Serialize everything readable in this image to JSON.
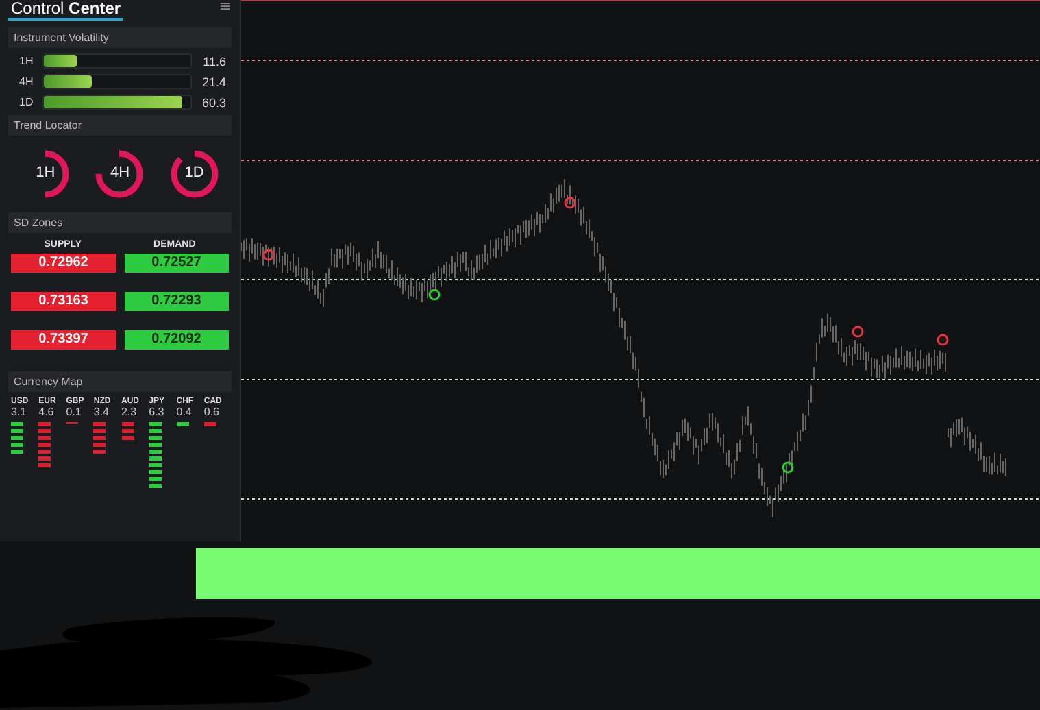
{
  "panel": {
    "title": "Control **Center**",
    "menu_icon": "≡"
  },
  "volatility": {
    "title": "Instrument Volatility",
    "rows": [
      {
        "label": "1H",
        "level": 0.22,
        "reading": "11.6"
      },
      {
        "label": "4H",
        "level": 0.33,
        "reading": "21.4"
      },
      {
        "label": "1D",
        "level": 0.94,
        "reading": "60.3"
      }
    ]
  },
  "trend": {
    "title": "Trend Locator",
    "rings": [
      {
        "label": "1H"
      },
      {
        "label": "4H"
      },
      {
        "label": "1D"
      }
    ]
  },
  "sd_zones": {
    "title": "SD Zones",
    "supply_heading": "SUPPLY",
    "demand_heading": "DEMAND",
    "rows": [
      {
        "supply": "0.72962",
        "demand": "0.72527"
      },
      {
        "supply": "0.73163",
        "demand": "0.72293"
      },
      {
        "supply": "0.73397",
        "demand": "0.72092"
      }
    ]
  },
  "currency_map": {
    "title": "Currency Map",
    "currencies": [
      {
        "name": "USD",
        "value": "3.1",
        "color": "#2ecc40"
      },
      {
        "name": "EUR",
        "value": "4.6",
        "color": "#d8202e"
      },
      {
        "name": "GBP",
        "value": "0.1",
        "color": "#d8202e"
      },
      {
        "name": "NZD",
        "value": "3.4",
        "color": "#d8202e"
      },
      {
        "name": "AUD",
        "value": "2.3",
        "color": "#d8202e"
      },
      {
        "name": "JPY",
        "value": "6.3",
        "color": "#2ecc40"
      },
      {
        "name": "CHF",
        "value": "0.4",
        "color": "#2ecc40"
      },
      {
        "name": "CAD",
        "value": "0.6",
        "color": "#d8202e"
      }
    ]
  }
}
